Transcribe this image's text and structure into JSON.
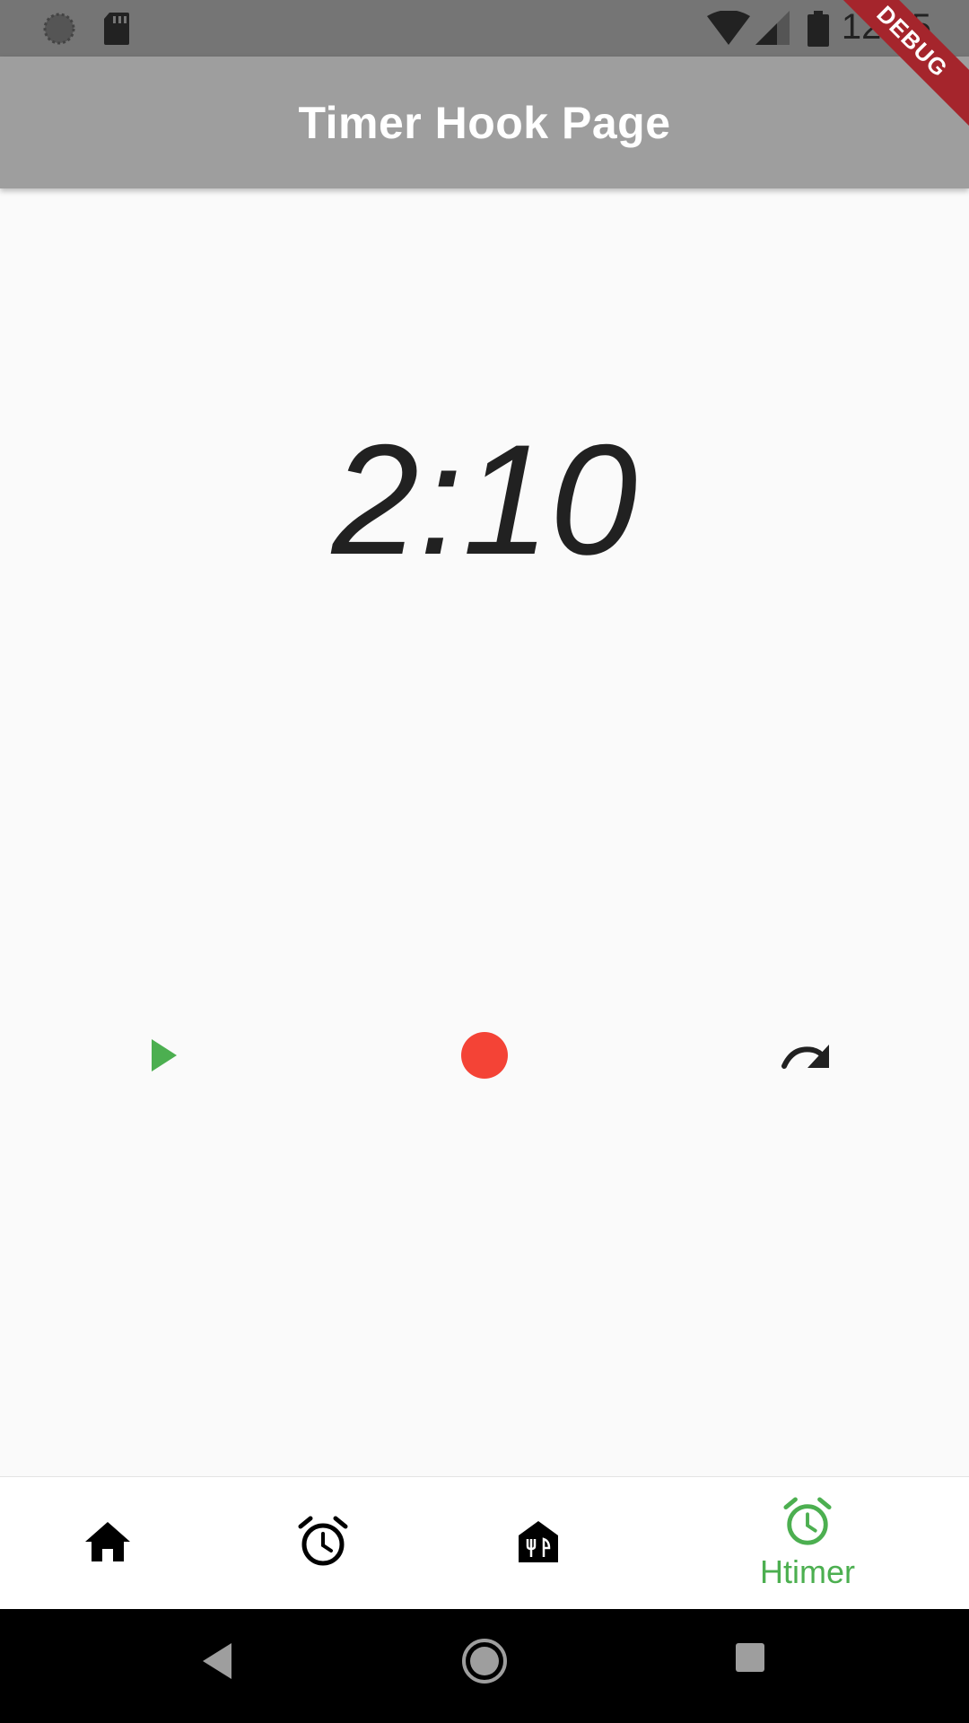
{
  "status_bar": {
    "time": "12:05",
    "icons": [
      "sync-icon",
      "sd-card-icon",
      "wifi-icon",
      "signal-icon",
      "battery-icon"
    ]
  },
  "debug_banner": {
    "label": "DEBUG"
  },
  "app_bar": {
    "title": "Timer Hook Page"
  },
  "timer": {
    "value": "2:10"
  },
  "controls": {
    "play": {
      "icon": "play-icon",
      "color": "#4caf50"
    },
    "stop": {
      "icon": "record-icon",
      "color": "#f44336"
    },
    "reset": {
      "icon": "redo-icon",
      "color": "#212121"
    }
  },
  "bottom_nav": {
    "items": [
      {
        "icon": "home-icon",
        "label": "",
        "active": false
      },
      {
        "icon": "alarm-icon",
        "label": "",
        "active": false
      },
      {
        "icon": "restaurant-icon",
        "label": "",
        "active": false
      },
      {
        "icon": "alarm-icon",
        "label": "Htimer",
        "active": true
      }
    ],
    "active_color": "#4caf50"
  },
  "system_nav": {
    "icons": [
      "back-icon",
      "home-circle-icon",
      "recents-icon"
    ]
  }
}
